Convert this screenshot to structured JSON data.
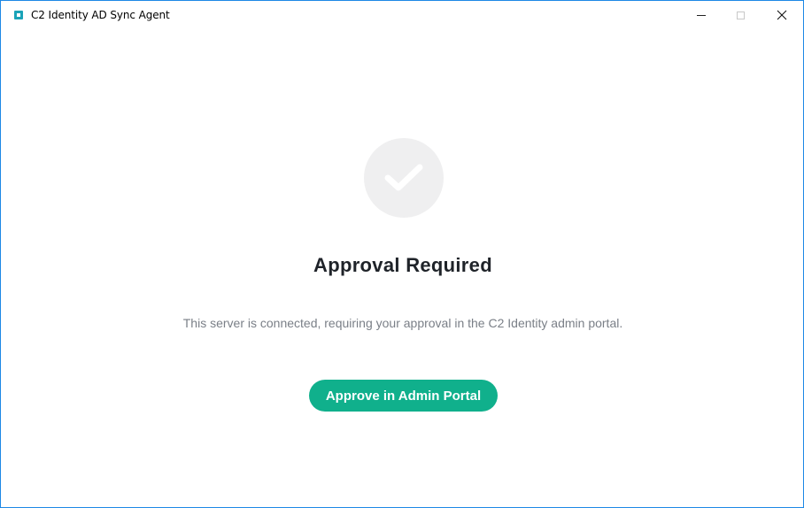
{
  "window": {
    "title": "C2 Identity AD Sync Agent",
    "border_color": "#1e88e5"
  },
  "icons": {
    "app": "app-logo-icon",
    "status": "check-icon",
    "minimize": "minimize-icon",
    "maximize": "maximize-icon",
    "close": "close-icon"
  },
  "main": {
    "heading": "Approval Required",
    "description": "This server is connected, requiring your approval in the C2 Identity admin portal.",
    "approve_button_label": "Approve in Admin Portal"
  },
  "colors": {
    "accent": "#10b08c",
    "heading": "#1f2329",
    "description": "#7a7f87",
    "status_circle": "#efeff0"
  }
}
